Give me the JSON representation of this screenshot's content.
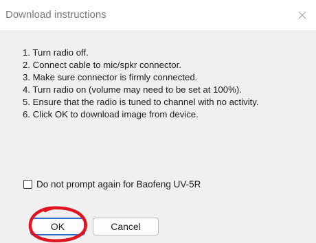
{
  "dialog": {
    "title": "Download instructions",
    "close_icon": "close-icon"
  },
  "instructions": [
    "1. Turn radio off.",
    "2. Connect cable to mic/spkr connector.",
    "3. Make sure connector is firmly connected.",
    "4. Turn radio on (volume may need to be set at 100%).",
    "5. Ensure that the radio is tuned to channel with no activity.",
    "6. Click OK to download image from device."
  ],
  "prompt_checkbox": {
    "label": "Do not prompt again for Baofeng UV-5R",
    "checked": false
  },
  "buttons": {
    "ok_label": "OK",
    "cancel_label": "Cancel"
  },
  "colors": {
    "annotation_circle": "#e0141e",
    "focus_border": "#2f6fc8"
  }
}
